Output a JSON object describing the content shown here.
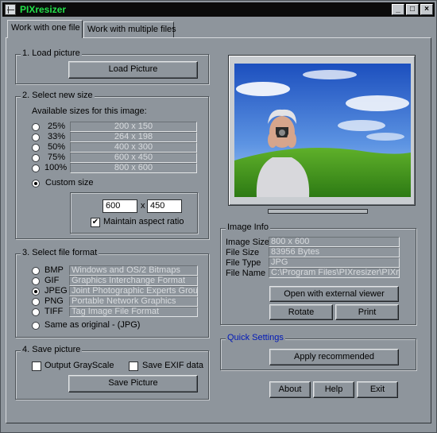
{
  "window": {
    "title": "PIXresizer",
    "min_glyph": "_",
    "max_glyph": "□",
    "close_glyph": "×"
  },
  "tabs": [
    {
      "label": "Work with one file"
    },
    {
      "label": "Work with multiple files"
    }
  ],
  "load_group": {
    "title": "1. Load picture",
    "button": "Load Picture"
  },
  "size_group": {
    "title": "2. Select new size",
    "available_label": "Available sizes for this image:",
    "options": [
      {
        "pct": "25%",
        "dims": "200 x 150"
      },
      {
        "pct": "33%",
        "dims": "264 x 198"
      },
      {
        "pct": "50%",
        "dims": "400 x 300"
      },
      {
        "pct": "75%",
        "dims": "600 x 450"
      },
      {
        "pct": "100%",
        "dims": "800 x 600"
      }
    ],
    "custom_label": "Custom size",
    "width_value": "600",
    "times": "x",
    "height_value": "450",
    "aspect_label": "Maintain aspect ratio",
    "aspect_checked": "✔"
  },
  "format_group": {
    "title": "3. Select file format",
    "options": [
      {
        "name": "BMP",
        "desc": "Windows and OS/2 Bitmaps"
      },
      {
        "name": "GIF",
        "desc": "Graphics Interchange Format"
      },
      {
        "name": "JPEG",
        "desc": "Joint Photographic Experts Group"
      },
      {
        "name": "PNG",
        "desc": "Portable Network Graphics"
      },
      {
        "name": "TIFF",
        "desc": "Tag Image File Format"
      }
    ],
    "same_label": "Same as original  - (JPG)"
  },
  "save_group": {
    "title": "4. Save picture",
    "grayscale_label": "Output GrayScale",
    "exif_label": "Save EXIF data",
    "button": "Save Picture"
  },
  "image_info": {
    "title": "Image Info",
    "rows": [
      {
        "label": "Image Size",
        "value": "800 x 600"
      },
      {
        "label": "File Size",
        "value": "83956 Bytes"
      },
      {
        "label": "File Type",
        "value": "JPG"
      },
      {
        "label": "File Name",
        "value": "C:\\Program Files\\PIXresizer\\PIXresizer"
      }
    ],
    "open_button": "Open with external viewer",
    "rotate_button": "Rotate",
    "print_button": "Print"
  },
  "quick_settings": {
    "title": "Quick Settings",
    "button": "Apply recommended"
  },
  "footer": {
    "about": "About",
    "help": "Help",
    "exit": "Exit"
  },
  "colors": {
    "accent_title": "#23e04a",
    "quick_settings": "#0018b8",
    "face": "#8e959c"
  }
}
